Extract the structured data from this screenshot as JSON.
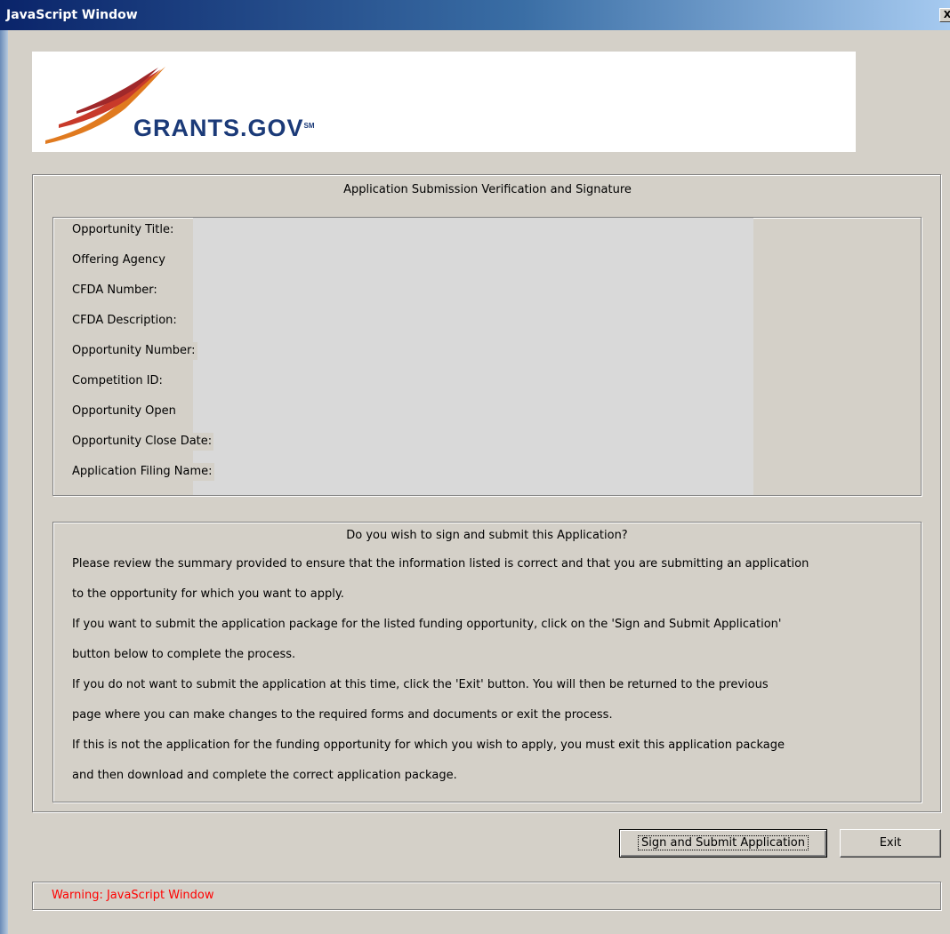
{
  "window": {
    "title": "JavaScript Window",
    "close_glyph": "X"
  },
  "logo": {
    "text": "GRANTS.GOV",
    "superscript": "SM"
  },
  "verification": {
    "title": "Application Submission Verification and Signature",
    "fields": [
      "Opportunity Title:",
      "Offering Agency",
      "CFDA Number:",
      "CFDA Description:",
      "Opportunity Number:",
      "Competition ID:",
      "Opportunity Open",
      "Opportunity Close Date:",
      "Application Filing Name:"
    ]
  },
  "question": {
    "title": "Do you wish to sign and submit this Application?",
    "lines": [
      "Please review the summary provided to ensure that the information listed is correct and that you are submitting an application",
      "to the opportunity for which you want to apply.",
      "If you want to submit the application package for the listed funding opportunity, click on the 'Sign and Submit Application'",
      "button below to complete the process.",
      "If you do not want to submit the application at this time, click the 'Exit' button. You will then be returned to the previous",
      "page where you can make changes to the required forms and documents or exit the process.",
      "If this is not the application for the funding opportunity for which you wish to apply, you must exit this application package",
      "and then download and complete the correct application package."
    ]
  },
  "buttons": {
    "sign_submit": "Sign and Submit Application",
    "exit": "Exit"
  },
  "warning": {
    "text": "Warning: JavaScript Window",
    "color": "#ff0000"
  }
}
